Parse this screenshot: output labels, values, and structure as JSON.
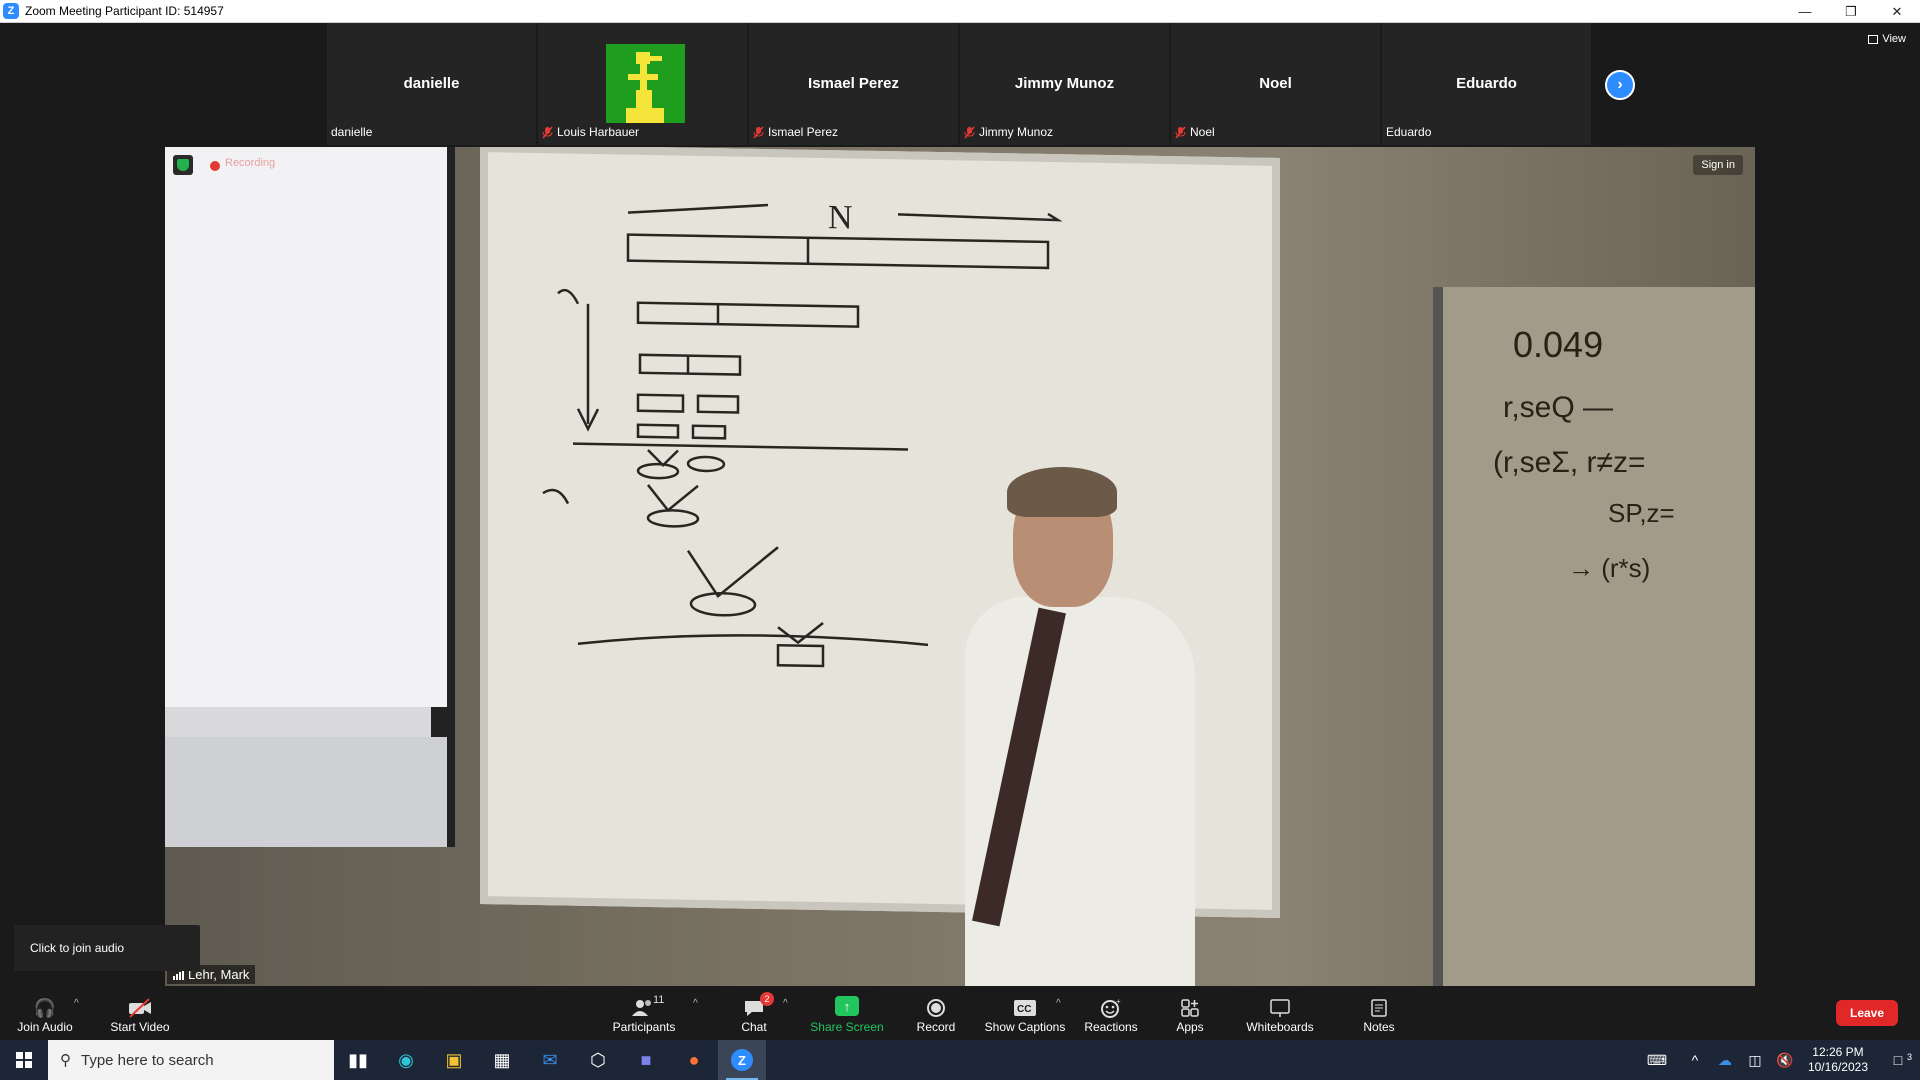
{
  "window": {
    "title": "Zoom Meeting Participant ID: 514957",
    "logo_letter": "Z"
  },
  "top_right": {
    "view_label": "View"
  },
  "participants_strip": [
    {
      "big_name": "danielle",
      "small_name": "danielle",
      "muted": false,
      "has_avatar": false
    },
    {
      "big_name": "",
      "small_name": "Louis Harbauer",
      "muted": true,
      "has_avatar": true
    },
    {
      "big_name": "Ismael Perez",
      "small_name": "Ismael Perez",
      "muted": true,
      "has_avatar": false
    },
    {
      "big_name": "Jimmy Munoz",
      "small_name": "Jimmy Munoz",
      "muted": true,
      "has_avatar": false
    },
    {
      "big_name": "Noel",
      "small_name": "Noel",
      "muted": true,
      "has_avatar": false
    },
    {
      "big_name": "Eduardo",
      "small_name": "Eduardo",
      "muted": false,
      "has_avatar": false
    }
  ],
  "video": {
    "sign_in_label": "Sign in",
    "recording_label": "Recording",
    "speaker_name": "Lehr, Mark"
  },
  "tooltip": {
    "join_audio_hint": "Click to join audio"
  },
  "toolbar": {
    "join_audio": "Join Audio",
    "start_video": "Start Video",
    "participants": "Participants",
    "participants_count": "11",
    "chat": "Chat",
    "chat_badge": "2",
    "share_screen": "Share Screen",
    "record": "Record",
    "show_captions": "Show Captions",
    "reactions": "Reactions",
    "apps": "Apps",
    "whiteboards": "Whiteboards",
    "notes": "Notes",
    "leave": "Leave"
  },
  "taskbar": {
    "search_placeholder": "Type here to search",
    "time": "12:26 PM",
    "date": "10/16/2023",
    "notification_count": "3"
  },
  "colors": {
    "zoom_blue": "#2d8cff",
    "share_green": "#22c55e",
    "leave_red": "#e02828"
  }
}
